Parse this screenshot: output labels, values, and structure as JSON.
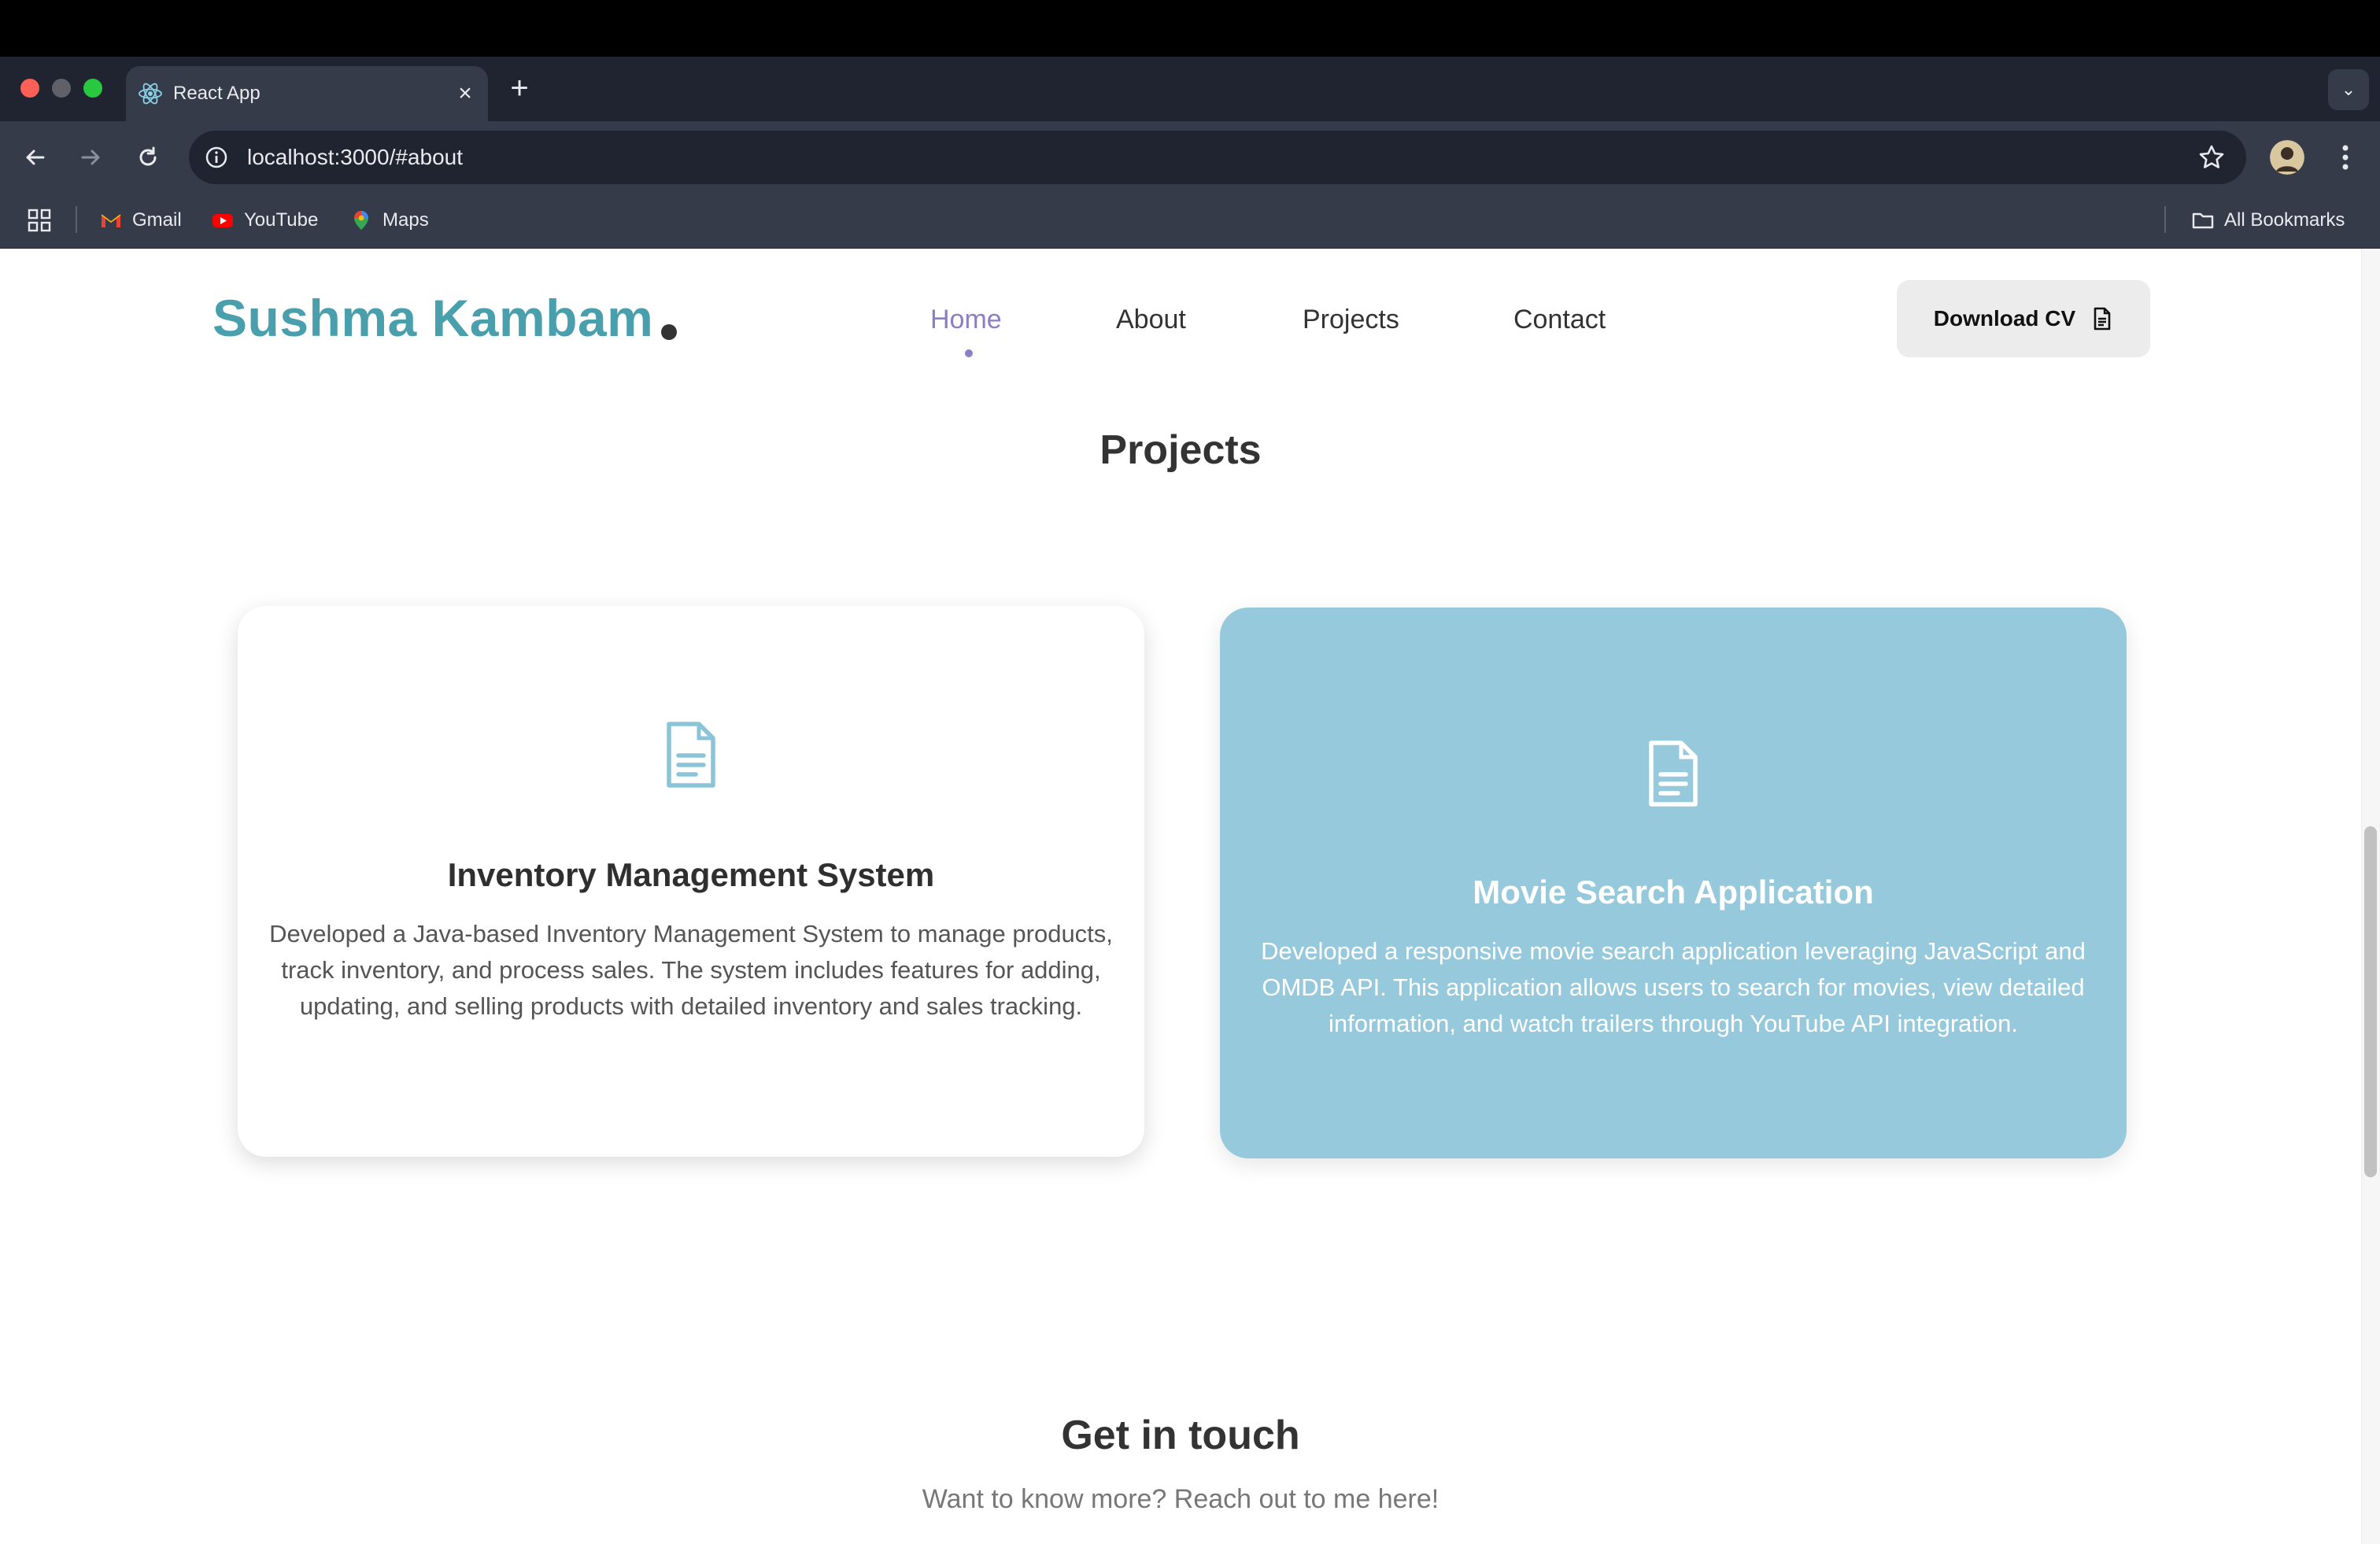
{
  "browser": {
    "tab_title": "React App",
    "url": "localhost:3000/#about",
    "bookmarks": [
      {
        "label": "Gmail"
      },
      {
        "label": "YouTube"
      },
      {
        "label": "Maps"
      }
    ],
    "all_bookmarks_label": "All Bookmarks"
  },
  "header": {
    "brand": "Sushma Kambam",
    "nav": [
      "Home",
      "About",
      "Projects",
      "Contact"
    ],
    "active_nav": "Home",
    "cv_button": "Download CV"
  },
  "projects": {
    "title": "Projects",
    "items": [
      {
        "title": "Inventory Management System",
        "description": "Developed a Java-based Inventory Management System to manage products, track inventory, and process sales. The system includes features for adding, updating, and selling products with detailed inventory and sales tracking."
      },
      {
        "title": "Movie Search Application",
        "description": "Developed a responsive movie search application leveraging JavaScript and OMDB API. This application allows users to search for movies, view detailed information, and watch trailers through YouTube API integration."
      }
    ]
  },
  "contact": {
    "title": "Get in touch",
    "subtitle": "Want to know more? Reach out to me here!"
  },
  "colors": {
    "brand": "#4a9fad",
    "nav_active": "#8c7ec2",
    "card_highlight": "#95c9db"
  }
}
